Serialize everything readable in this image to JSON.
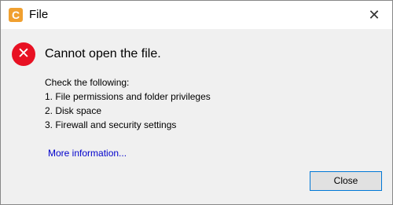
{
  "window": {
    "title": "File",
    "app_icon_letter": "C",
    "icon_color": "#f0a030"
  },
  "message": {
    "heading": "Cannot open the file.",
    "intro": "Check the following:",
    "items": [
      "1. File permissions and folder privileges",
      "2. Disk space",
      "3. Firewall and security settings"
    ]
  },
  "link": {
    "label": "More information..."
  },
  "buttons": {
    "close_label": "Close"
  },
  "icons": {
    "error": "error-circle-icon",
    "close": "close-icon"
  },
  "colors": {
    "error": "#e81123",
    "link": "#0000cc",
    "focus_border": "#0078d7"
  }
}
